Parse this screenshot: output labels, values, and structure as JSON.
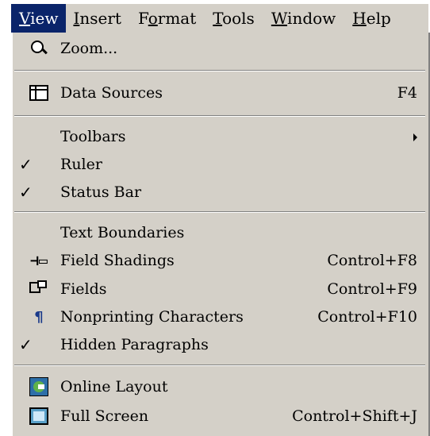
{
  "menubar": {
    "items": [
      {
        "pre": "",
        "u": "V",
        "post": "iew",
        "active": true
      },
      {
        "pre": "",
        "u": "I",
        "post": "nsert",
        "active": false
      },
      {
        "pre": "F",
        "u": "o",
        "post": "rmat",
        "active": false
      },
      {
        "pre": "",
        "u": "T",
        "post": "ools",
        "active": false
      },
      {
        "pre": "",
        "u": "W",
        "post": "indow",
        "active": false
      },
      {
        "pre": "",
        "u": "H",
        "post": "elp",
        "active": false
      }
    ]
  },
  "view_menu": {
    "zoom": {
      "pre": "",
      "u": "Z",
      "post": "oom...",
      "icon": "magnifier-icon"
    },
    "data_sources": {
      "pre": "",
      "u": "D",
      "post": "ata Sources",
      "shortcut": "F4",
      "icon": "table-icon"
    },
    "toolbars": {
      "pre": "",
      "u": "T",
      "post": "oolbars"
    },
    "ruler": {
      "pre": "",
      "u": "R",
      "post": "uler",
      "checked": true
    },
    "status_bar": {
      "pre": "",
      "u": "S",
      "post": "tatus Bar",
      "checked": true
    },
    "text_boundaries": {
      "pre": "Te",
      "u": "x",
      "post": "t Boundaries"
    },
    "field_shadings": {
      "pre": "Fie",
      "u": "l",
      "post": "d Shadings",
      "shortcut": "Control+F8",
      "icon": "field-shading-icon"
    },
    "fields": {
      "pre": "",
      "u": "F",
      "post": "ields",
      "shortcut": "Control+F9",
      "icon": "fields-icon"
    },
    "nonprinting": {
      "pre": "",
      "u": "N",
      "post": "onprinting Characters",
      "shortcut": "Control+F10",
      "icon": "pilcrow-icon"
    },
    "hidden_paragraphs": {
      "pre": "",
      "u": "H",
      "post": "idden Paragraphs",
      "checked": true
    },
    "online_layout": {
      "pre": "",
      "u": "O",
      "post": "nline Layout",
      "icon": "online-layout-icon"
    },
    "full_screen": {
      "pre": "F",
      "u": "u",
      "post": "ll Screen",
      "shortcut": "Control+Shift+J",
      "icon": "full-screen-icon"
    },
    "check_glyph": "✓",
    "shading_glyph": "⊣▭",
    "pilcrow_glyph": "¶"
  }
}
